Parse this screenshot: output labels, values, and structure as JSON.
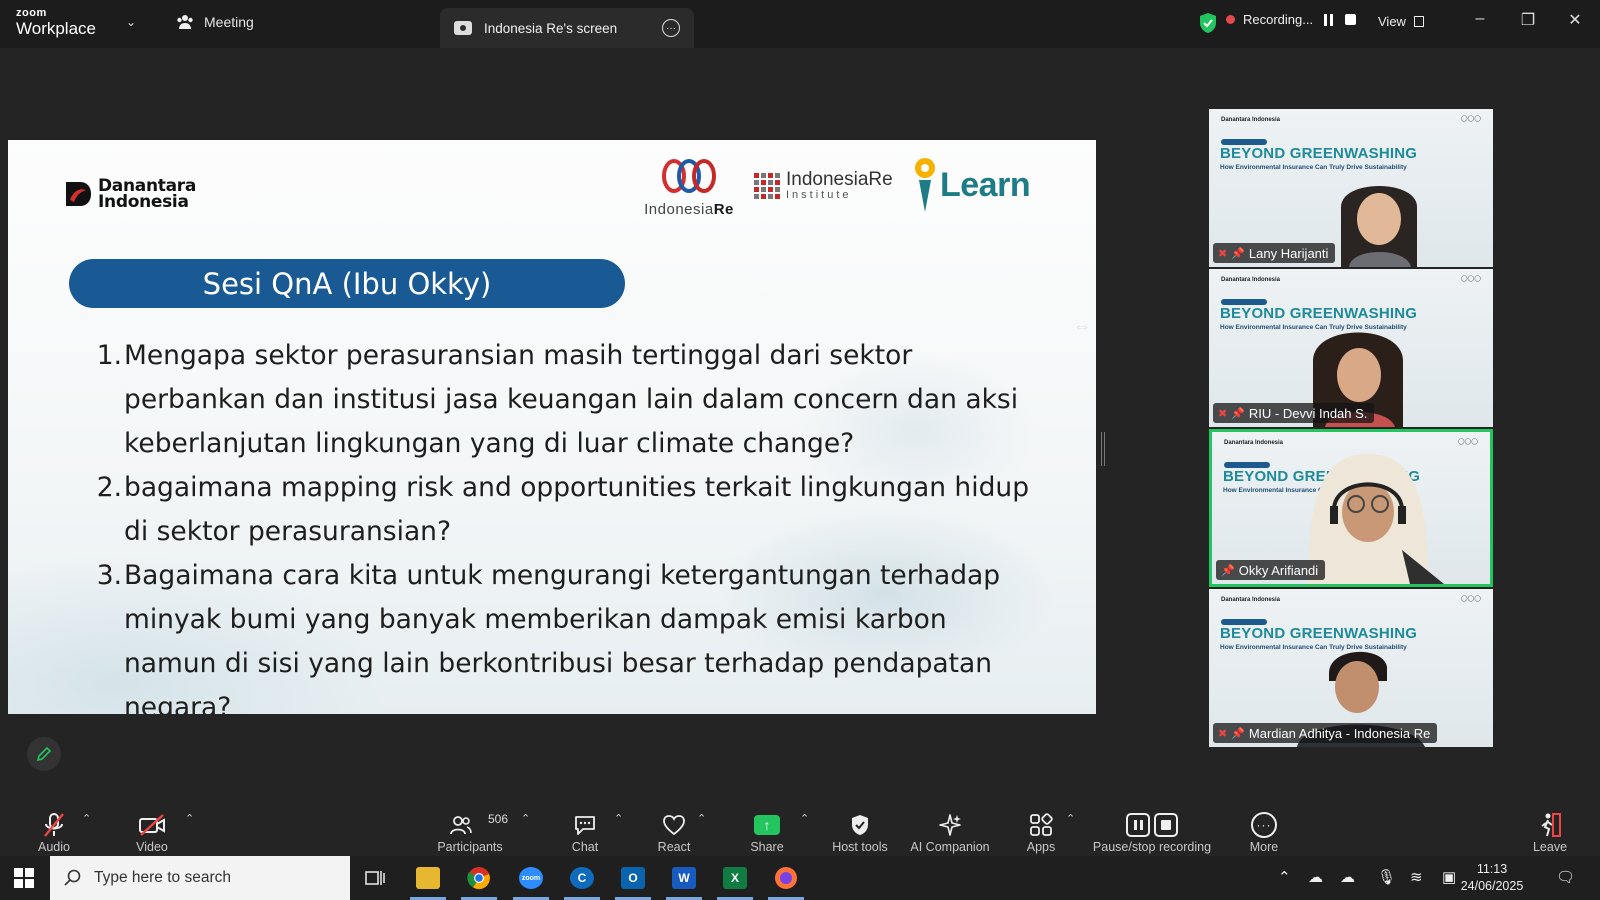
{
  "app": {
    "brand_small": "zoom",
    "brand_big": "Workplace"
  },
  "titlebar": {
    "meeting_tab": "Meeting",
    "screen_tab": "Indonesia Re's screen",
    "recording_label": "Recording...",
    "view_label": "View"
  },
  "slide": {
    "danantara_line1": "Danantara",
    "danantara_line2": "Indonesia",
    "ire_name_a": "Indonesia",
    "ire_name_b": "Re",
    "iri_line1": "IndonesiaRe",
    "iri_line2": "Institute",
    "learn_text": "Learn",
    "pill_title": "Sesi QnA (Ibu Okky)",
    "questions": [
      {
        "num": "1.",
        "text": "Mengapa sektor perasuransian masih tertinggal dari sektor perbankan dan institusi jasa keuangan lain dalam concern dan aksi keberlanjutan lingkungan yang di luar climate change?"
      },
      {
        "num": "2.",
        "text": "bagaimana mapping risk and opportunities terkait lingkungan hidup di sektor perasuransian?"
      },
      {
        "num": "3.",
        "text": "Bagaimana cara kita untuk mengurangi ketergantungan terhadap minyak bumi yang banyak memberikan dampak emisi karbon namun di sisi yang lain berkontribusi besar terhadap pendapatan negara?"
      }
    ]
  },
  "tiles": {
    "headline": "BEYOND GREENWASHING",
    "subline": "How Environmental Insurance Can Truly Drive Sustainability",
    "mini_logo": "Danantara Indonesia",
    "participants": [
      {
        "name": "Lany Harijanti",
        "muted": true,
        "active": false
      },
      {
        "name": "RIU - Devvi Indah S.",
        "muted": true,
        "active": false
      },
      {
        "name": "Okky Arifiandi",
        "muted": false,
        "active": true
      },
      {
        "name": "Mardian Adhitya - Indonesia Re",
        "muted": true,
        "active": false
      }
    ]
  },
  "toolbar": {
    "audio": "Audio",
    "video": "Video",
    "participants": "Participants",
    "participant_count": "506",
    "chat": "Chat",
    "react": "React",
    "share": "Share",
    "host_tools": "Host tools",
    "ai_companion": "AI Companion",
    "apps": "Apps",
    "pause_stop": "Pause/stop recording",
    "more": "More",
    "leave": "Leave"
  },
  "taskbar": {
    "search_placeholder": "Type here to search",
    "time": "11:13",
    "date": "24/06/2025"
  },
  "colors": {
    "accent_green": "#22c55e",
    "record_red": "#e5484d",
    "pill_blue": "#1a5a94",
    "headline_teal": "#1f8a99"
  }
}
